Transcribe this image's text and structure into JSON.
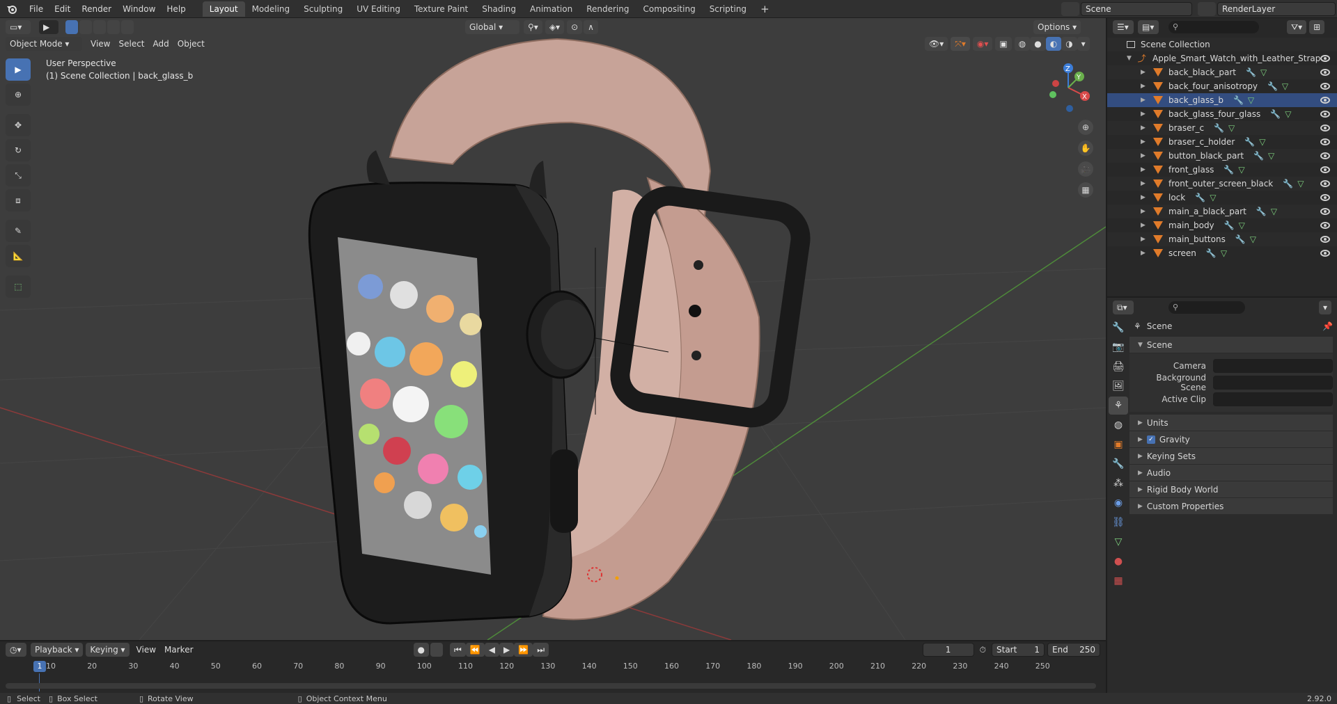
{
  "topbar": {
    "menus": [
      "File",
      "Edit",
      "Render",
      "Window",
      "Help"
    ],
    "workspaces": [
      "Layout",
      "Modeling",
      "Sculpting",
      "UV Editing",
      "Texture Paint",
      "Shading",
      "Animation",
      "Rendering",
      "Compositing",
      "Scripting"
    ],
    "active_workspace": "Layout",
    "scene": "Scene",
    "render_layer": "RenderLayer"
  },
  "viewport": {
    "mode": "Object Mode",
    "menus": [
      "View",
      "Select",
      "Add",
      "Object"
    ],
    "transform_orientation": "Global",
    "options_label": "Options",
    "overlay_title": "User Perspective",
    "overlay_subtitle": "(1) Scene Collection | back_glass_b",
    "gizmo": {
      "z": "Z",
      "y": "Y",
      "x": "X"
    }
  },
  "outliner": {
    "root": "Scene Collection",
    "collection": "Apple_Smart_Watch_with_Leather_Strap",
    "items": [
      "back_black_part",
      "back_four_anisotropy",
      "back_glass_b",
      "back_glass_four_glass",
      "braser_c",
      "braser_c_holder",
      "button_black_part",
      "front_glass",
      "front_outer_screen_black",
      "lock",
      "main_a_black_part",
      "main_body",
      "main_buttons",
      "screen"
    ]
  },
  "properties": {
    "context": "Scene",
    "panel": "Scene",
    "fields": [
      {
        "label": "Camera",
        "value": ""
      },
      {
        "label": "Background Scene",
        "value": ""
      },
      {
        "label": "Active Clip",
        "value": ""
      }
    ],
    "subpanels": [
      "Units",
      "Gravity",
      "Keying Sets",
      "Audio",
      "Rigid Body World",
      "Custom Properties"
    ]
  },
  "timeline": {
    "menus": [
      "Playback",
      "Keying",
      "View",
      "Marker"
    ],
    "current_frame": "1",
    "start_label": "Start",
    "start": "1",
    "end_label": "End",
    "end": "250",
    "ruler": [
      "10",
      "20",
      "30",
      "40",
      "50",
      "60",
      "70",
      "80",
      "90",
      "100",
      "110",
      "120",
      "130",
      "140",
      "150",
      "160",
      "170",
      "180",
      "190",
      "200",
      "210",
      "220",
      "230",
      "240",
      "250"
    ],
    "playhead": "1"
  },
  "statusbar": {
    "select": "Select",
    "box_select": "Box Select",
    "rotate": "Rotate View",
    "context_menu": "Object Context Menu",
    "version": "2.92.0"
  },
  "colors": {
    "accent": "#4772b3",
    "object_orange": "#e07b2a",
    "strap": "#c9a59a",
    "bg_viewport": "#3d3d3d"
  }
}
